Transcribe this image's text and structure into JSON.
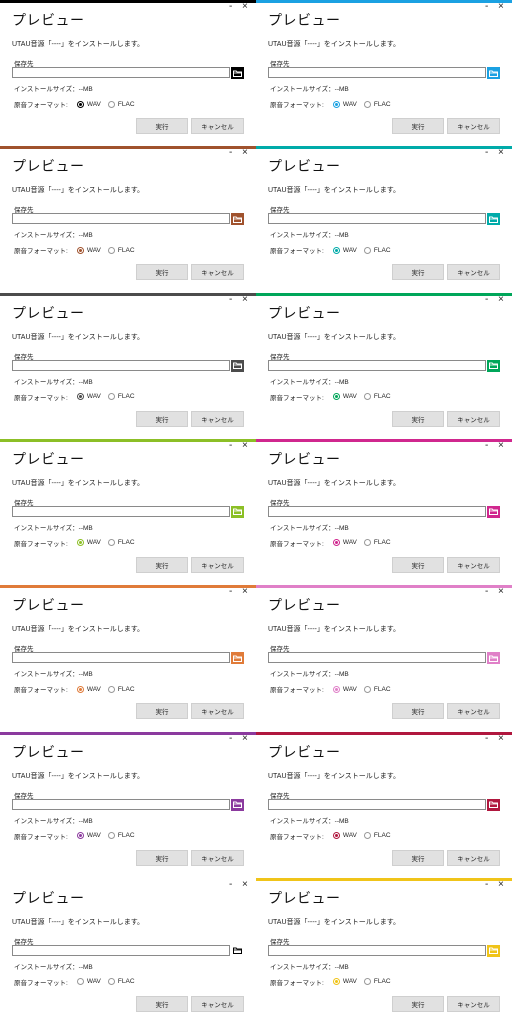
{
  "labels": {
    "title": "プレビュー",
    "minimize": "-",
    "close": "×",
    "message": "UTAU音源「----」をインストールします。",
    "save_label": "保存先",
    "path_value": "",
    "install_size": "インストールサイズ：--MB",
    "format_label": "原音フォーマット:",
    "wav": "WAV",
    "flac": "FLAC",
    "run": "実行",
    "cancel": "キャンセル"
  },
  "panels": [
    {
      "accent": "#000000",
      "folder_bg": "#000000",
      "selected": "wav"
    },
    {
      "accent": "#1ba1e2",
      "folder_bg": "#1ba1e2",
      "selected": "wav"
    },
    {
      "accent": "#a0522d",
      "folder_bg": "#a0522d",
      "selected": "wav"
    },
    {
      "accent": "#00aba9",
      "folder_bg": "#00aba9",
      "selected": "wav"
    },
    {
      "accent": "#4c4c4c",
      "folder_bg": "#4c4c4c",
      "selected": "wav"
    },
    {
      "accent": "#00a65a",
      "folder_bg": "#00a65a",
      "selected": "wav"
    },
    {
      "accent": "#8cbf26",
      "folder_bg": "#8cbf26",
      "selected": "wav"
    },
    {
      "accent": "#d0278e",
      "folder_bg": "#d0278e",
      "selected": "wav"
    },
    {
      "accent": "#e07b39",
      "folder_bg": "#e07b39",
      "selected": "wav"
    },
    {
      "accent": "#e080c8",
      "folder_bg": "#e080c8",
      "selected": "wav"
    },
    {
      "accent": "#8b3a9e",
      "folder_bg": "#8b3a9e",
      "selected": "wav"
    },
    {
      "accent": "#b0173e",
      "folder_bg": "#b0173e",
      "selected": "wav"
    },
    {
      "accent": "#ffffff",
      "folder_bg": "#ffffff",
      "selected": "none"
    },
    {
      "accent": "#f0c419",
      "folder_bg": "#f0c419",
      "selected": "wav"
    }
  ]
}
